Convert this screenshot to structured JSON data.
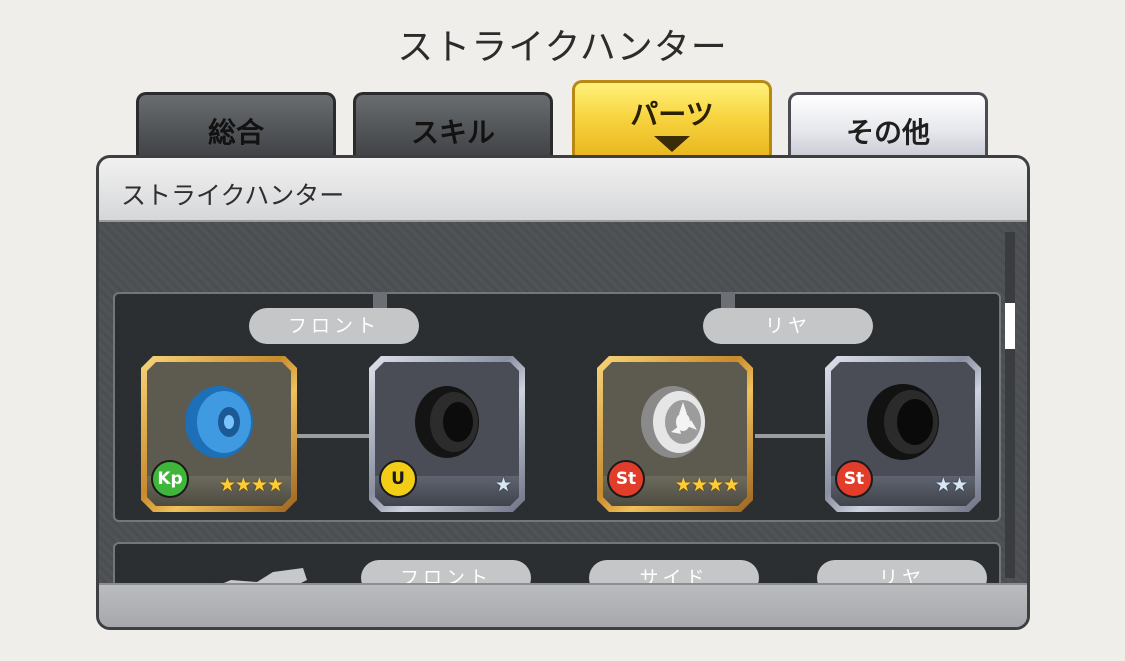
{
  "title": "ストライクハンター",
  "tabs": [
    {
      "label": "総合"
    },
    {
      "label": "スキル"
    },
    {
      "label": "パーツ"
    },
    {
      "label": "その他"
    }
  ],
  "panel": {
    "header": "ストライクハンター",
    "section1": {
      "front_label": "フロント",
      "rear_label": "リヤ",
      "slots": [
        {
          "part": "blue-wheel",
          "frame": "gold",
          "badge": "Kp",
          "badge_color": "#3fb53a",
          "stars": "★★★★"
        },
        {
          "part": "black-tire",
          "frame": "silver",
          "badge": "U",
          "badge_color": "#f2cf16",
          "stars": "★"
        },
        {
          "part": "white-wheel",
          "frame": "gold",
          "badge": "St",
          "badge_color": "#e23c2a",
          "stars": "★★★★"
        },
        {
          "part": "black-tire",
          "frame": "silver",
          "badge": "St",
          "badge_color": "#e23c2a",
          "stars": "★★"
        }
      ]
    },
    "section2": {
      "front_label": "フロント",
      "side_label": "サイド",
      "rear_label": "リヤ"
    }
  },
  "colors": {
    "active_tab": "#f7d33e",
    "dark_tab": "#55585b",
    "light_tab": "#e6e7ec",
    "panel_body": "#505356"
  }
}
